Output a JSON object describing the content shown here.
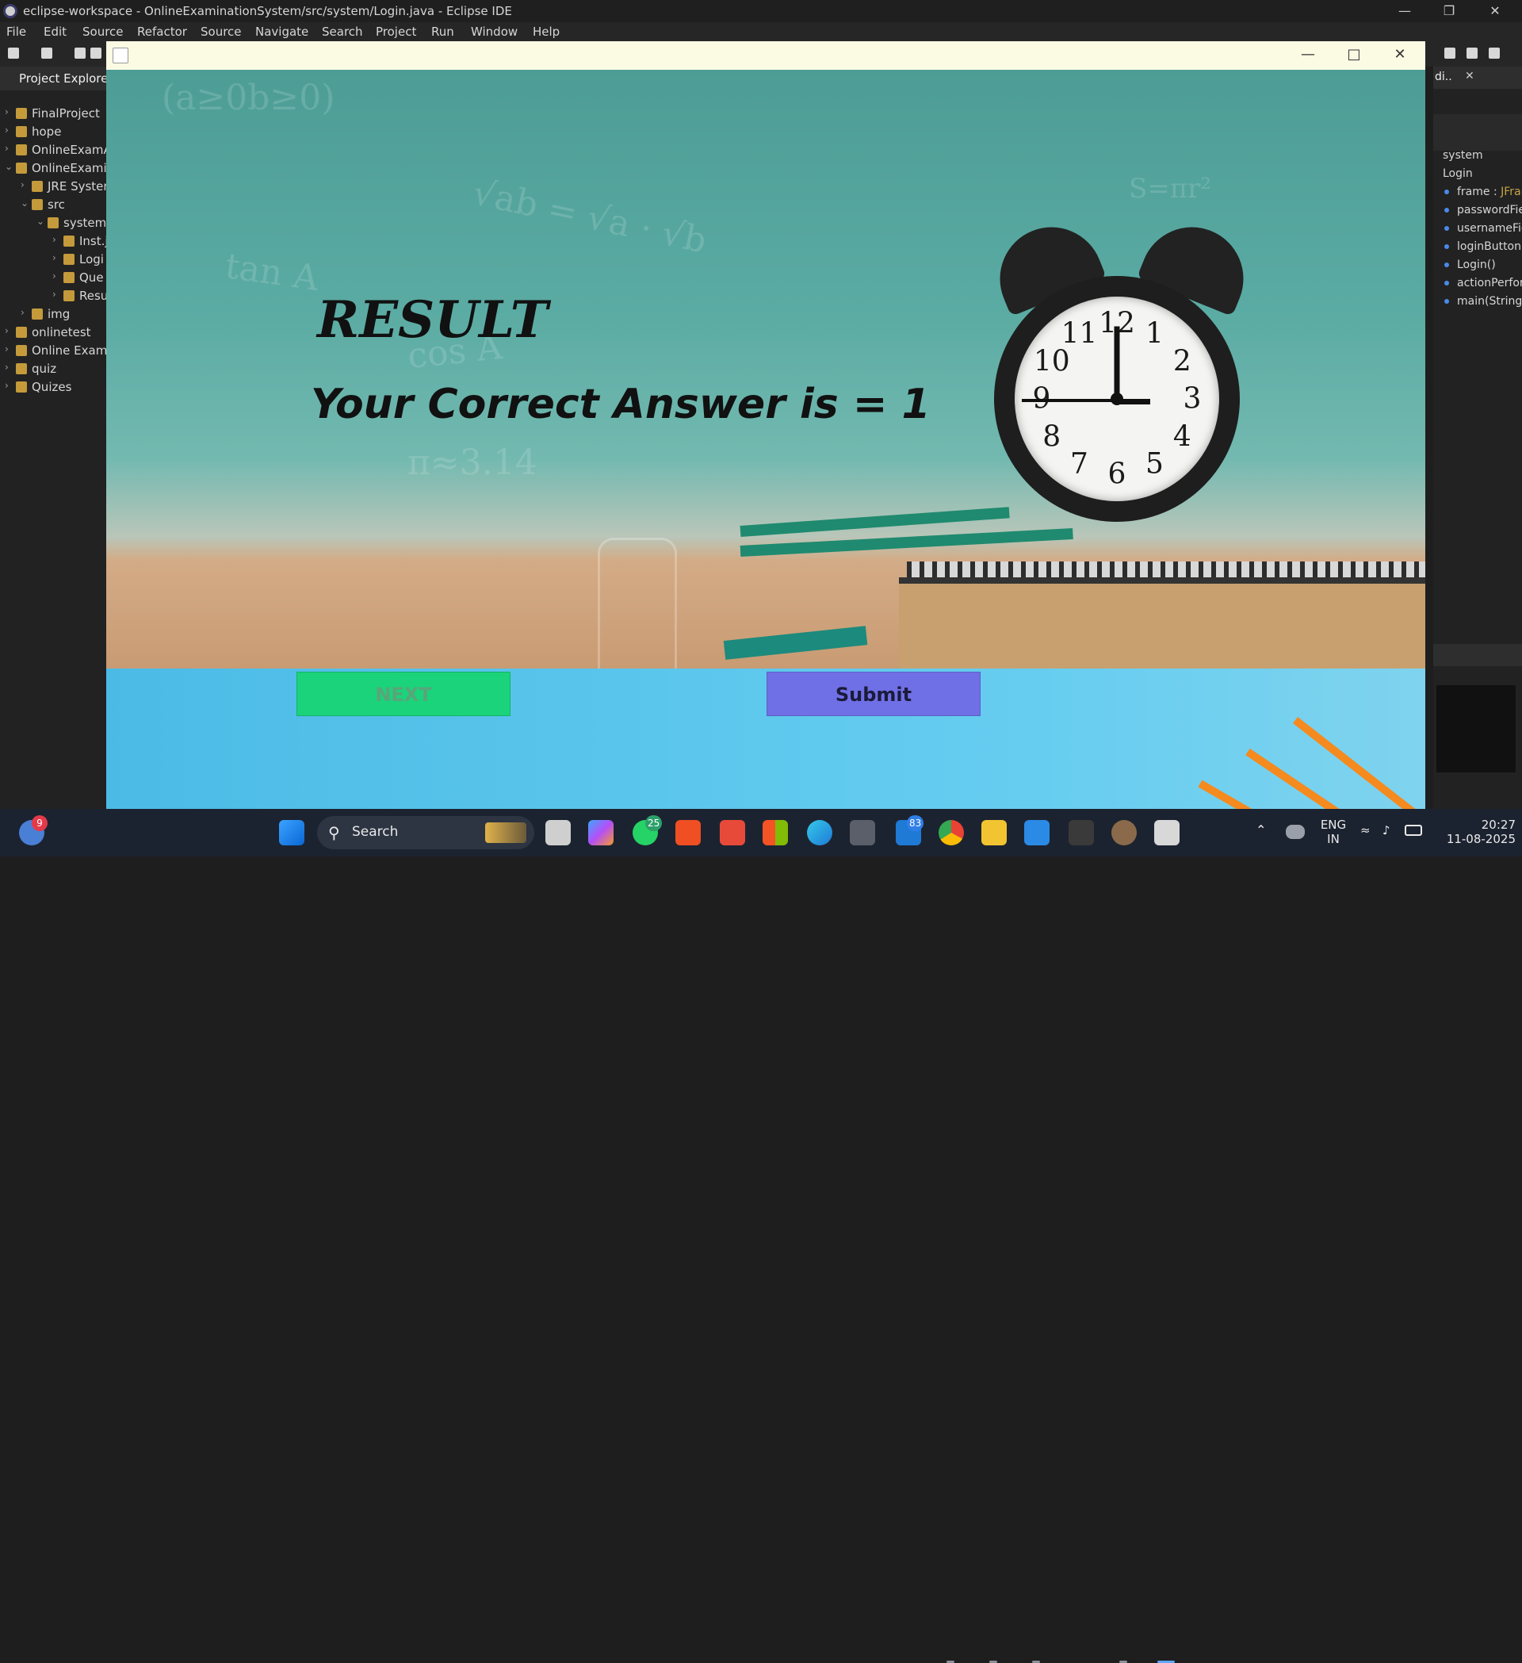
{
  "ide": {
    "title": "eclipse-workspace - OnlineExaminationSystem/src/system/Login.java - Eclipse IDE",
    "menu": [
      "File",
      "Edit",
      "Source",
      "Refactor",
      "Source",
      "Navigate",
      "Search",
      "Project",
      "Run",
      "Window",
      "Help"
    ],
    "project_explorer": {
      "header": "Project Explorer",
      "items": [
        {
          "label": "FinalProject",
          "indent": 0,
          "expanded": false
        },
        {
          "label": "hope",
          "indent": 0,
          "expanded": false
        },
        {
          "label": "OnlineExamA",
          "indent": 0,
          "expanded": false
        },
        {
          "label": "OnlineExamin",
          "indent": 0,
          "expanded": true
        },
        {
          "label": "JRE Systen",
          "indent": 1,
          "expanded": false
        },
        {
          "label": "src",
          "indent": 1,
          "expanded": true
        },
        {
          "label": "system",
          "indent": 2,
          "expanded": true
        },
        {
          "label": "Inst.j",
          "indent": 3,
          "expanded": false
        },
        {
          "label": "Logi",
          "indent": 3,
          "expanded": false
        },
        {
          "label": "Que",
          "indent": 3,
          "expanded": false
        },
        {
          "label": "Resu",
          "indent": 3,
          "expanded": false
        },
        {
          "label": "img",
          "indent": 1,
          "expanded": false
        },
        {
          "label": "onlinetest",
          "indent": 0,
          "expanded": false
        },
        {
          "label": "Online Exam",
          "indent": 0,
          "expanded": false
        },
        {
          "label": "quiz",
          "indent": 0,
          "expanded": false
        },
        {
          "label": "Quizes",
          "indent": 0,
          "expanded": false
        }
      ]
    },
    "outline": {
      "tab_label": "di..",
      "items": [
        {
          "label": "system",
          "type": ""
        },
        {
          "label": "Login",
          "type": ""
        },
        {
          "label": "frame : ",
          "type": "JFran"
        },
        {
          "label": "passwordFie",
          "type": ""
        },
        {
          "label": "usernameFie",
          "type": ""
        },
        {
          "label": "loginButton",
          "type": ""
        },
        {
          "label": "Login()",
          "type": ""
        },
        {
          "label": "actionPerfor",
          "type": ""
        },
        {
          "label": "main(String",
          "type": ""
        }
      ]
    }
  },
  "app": {
    "heading": "RESULT",
    "result_text": "Your Correct Answer is = 1",
    "next_label": "NEXT",
    "submit_label": "Submit",
    "chalk_text": [
      "(a≥0b≥0)",
      "√ab = √a · √b",
      "tan A",
      "cos A",
      "π≈3.14",
      "S=πr²"
    ],
    "clock_numbers": [
      "12",
      "1",
      "2",
      "3",
      "4",
      "5",
      "6",
      "7",
      "8",
      "9",
      "10",
      "11"
    ]
  },
  "taskbar": {
    "search_placeholder": "Search",
    "weather_badge": "9",
    "whatsapp_badge": "25",
    "mail_badge": "83",
    "lang_top": "ENG",
    "lang_bottom": "IN",
    "time": "20:27",
    "date": "11-08-2025"
  },
  "colors": {
    "next_bg": "#1bd37a",
    "submit_bg": "#6f70e6",
    "frame_title_bg": "#fbfbe4"
  }
}
